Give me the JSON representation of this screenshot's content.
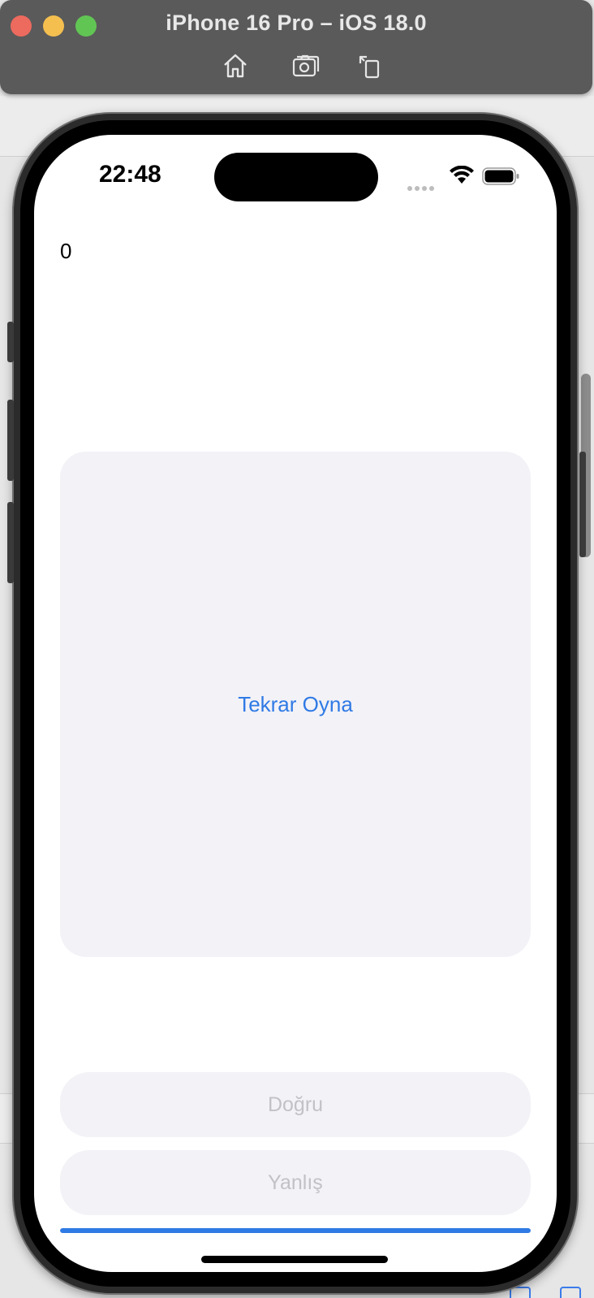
{
  "window": {
    "title": "iPhone 16 Pro – iOS 18.0",
    "toolbar_icons": [
      "home-icon",
      "screenshot-icon",
      "rotate-icon"
    ]
  },
  "status_bar": {
    "time": "22:48",
    "icons": [
      "cellular-signal-icon",
      "wifi-icon",
      "battery-icon"
    ]
  },
  "app": {
    "score": "0",
    "card_button_label": "Tekrar Oyna",
    "true_button_label": "Doğru",
    "false_button_label": "Yanlış",
    "progress": 1.0
  },
  "colors": {
    "accent": "#2f7ae5",
    "card_background": "#f2f2f7",
    "disabled_text": "#c2c2c6",
    "titlebar": "#5a5a5a"
  }
}
